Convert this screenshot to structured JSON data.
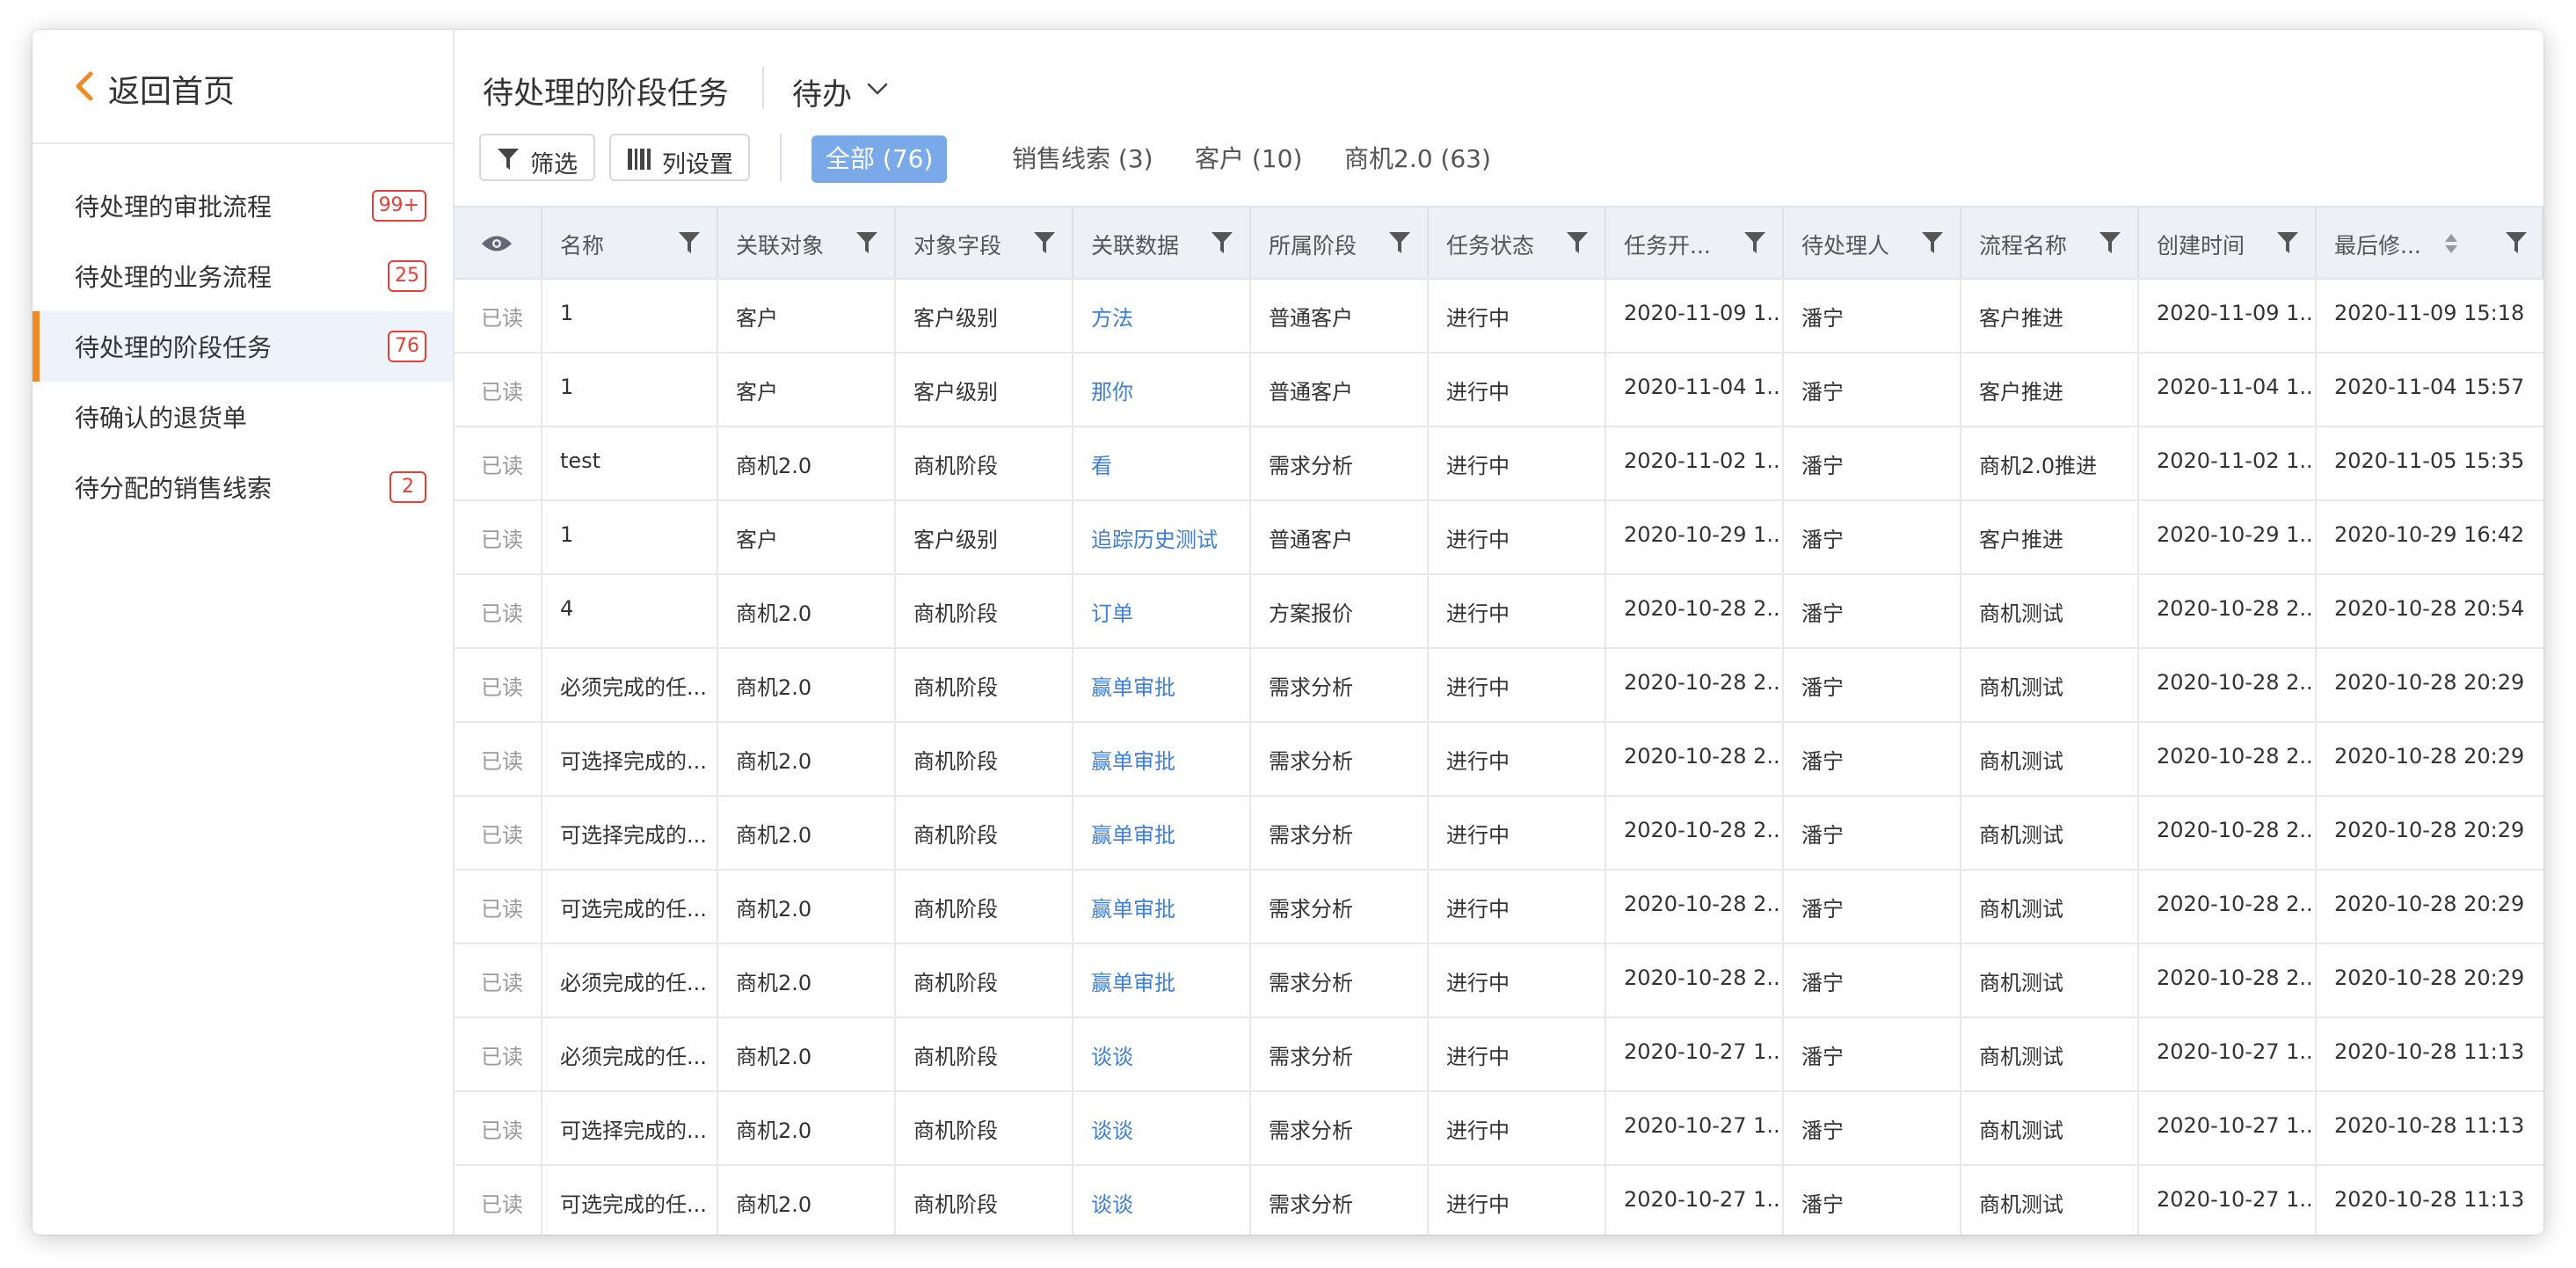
{
  "sidebar": {
    "back_label": "返回首页",
    "items": [
      {
        "label": "待处理的审批流程",
        "badge": "99+"
      },
      {
        "label": "待处理的业务流程",
        "badge": "25"
      },
      {
        "label": "待处理的阶段任务",
        "badge": "76",
        "active": true
      },
      {
        "label": "待确认的退货单",
        "badge": ""
      },
      {
        "label": "待分配的销售线索",
        "badge": "2"
      }
    ]
  },
  "header": {
    "title": "待处理的阶段任务",
    "view_select": "待办",
    "filter_button": "筛选",
    "columns_button": "列设置",
    "tabs": [
      {
        "label": "全部 (76)",
        "active": true
      },
      {
        "label": "销售线索 (3)"
      },
      {
        "label": "客户 (10)"
      },
      {
        "label": "商机2.0 (63)"
      }
    ]
  },
  "table": {
    "columns": [
      "名称",
      "关联对象",
      "对象字段",
      "关联数据",
      "所属阶段",
      "任务状态",
      "任务开...",
      "待处理人",
      "流程名称",
      "创建时间",
      "最后修..."
    ],
    "rows": [
      {
        "read": "已读",
        "cells": [
          "1",
          "客户",
          "客户级别",
          "方法",
          "普通客户",
          "进行中",
          "2020-11-09 1...",
          "潘宁",
          "客户推进",
          "2020-11-09 1...",
          "2020-11-09 15:18"
        ]
      },
      {
        "read": "已读",
        "cells": [
          "1",
          "客户",
          "客户级别",
          "那你",
          "普通客户",
          "进行中",
          "2020-11-04 1...",
          "潘宁",
          "客户推进",
          "2020-11-04 1...",
          "2020-11-04 15:57"
        ]
      },
      {
        "read": "已读",
        "cells": [
          "test",
          "商机2.0",
          "商机阶段",
          "看",
          "需求分析",
          "进行中",
          "2020-11-02 1...",
          "潘宁",
          "商机2.0推进",
          "2020-11-02 1...",
          "2020-11-05 15:35"
        ]
      },
      {
        "read": "已读",
        "cells": [
          "1",
          "客户",
          "客户级别",
          "追踪历史测试",
          "普通客户",
          "进行中",
          "2020-10-29 1...",
          "潘宁",
          "客户推进",
          "2020-10-29 1...",
          "2020-10-29 16:42"
        ]
      },
      {
        "read": "已读",
        "cells": [
          "4",
          "商机2.0",
          "商机阶段",
          "订单",
          "方案报价",
          "进行中",
          "2020-10-28 2...",
          "潘宁",
          "商机测试",
          "2020-10-28 2...",
          "2020-10-28 20:54"
        ]
      },
      {
        "read": "已读",
        "cells": [
          "必须完成的任...",
          "商机2.0",
          "商机阶段",
          "赢单审批",
          "需求分析",
          "进行中",
          "2020-10-28 2...",
          "潘宁",
          "商机测试",
          "2020-10-28 2...",
          "2020-10-28 20:29"
        ]
      },
      {
        "read": "已读",
        "cells": [
          "可选择完成的...",
          "商机2.0",
          "商机阶段",
          "赢单审批",
          "需求分析",
          "进行中",
          "2020-10-28 2...",
          "潘宁",
          "商机测试",
          "2020-10-28 2...",
          "2020-10-28 20:29"
        ]
      },
      {
        "read": "已读",
        "cells": [
          "可选择完成的...",
          "商机2.0",
          "商机阶段",
          "赢单审批",
          "需求分析",
          "进行中",
          "2020-10-28 2...",
          "潘宁",
          "商机测试",
          "2020-10-28 2...",
          "2020-10-28 20:29"
        ]
      },
      {
        "read": "已读",
        "cells": [
          "可选完成的任...",
          "商机2.0",
          "商机阶段",
          "赢单审批",
          "需求分析",
          "进行中",
          "2020-10-28 2...",
          "潘宁",
          "商机测试",
          "2020-10-28 2...",
          "2020-10-28 20:29"
        ]
      },
      {
        "read": "已读",
        "cells": [
          "必须完成的任...",
          "商机2.0",
          "商机阶段",
          "赢单审批",
          "需求分析",
          "进行中",
          "2020-10-28 2...",
          "潘宁",
          "商机测试",
          "2020-10-28 2...",
          "2020-10-28 20:29"
        ]
      },
      {
        "read": "已读",
        "cells": [
          "必须完成的任...",
          "商机2.0",
          "商机阶段",
          "谈谈",
          "需求分析",
          "进行中",
          "2020-10-27 1...",
          "潘宁",
          "商机测试",
          "2020-10-27 1...",
          "2020-10-28 11:13"
        ]
      },
      {
        "read": "已读",
        "cells": [
          "可选择完成的...",
          "商机2.0",
          "商机阶段",
          "谈谈",
          "需求分析",
          "进行中",
          "2020-10-27 1...",
          "潘宁",
          "商机测试",
          "2020-10-27 1...",
          "2020-10-28 11:13"
        ]
      },
      {
        "read": "已读",
        "cells": [
          "可选完成的任...",
          "商机2.0",
          "商机阶段",
          "谈谈",
          "需求分析",
          "进行中",
          "2020-10-27 1...",
          "潘宁",
          "商机测试",
          "2020-10-27 1...",
          "2020-10-28 11:13"
        ]
      }
    ]
  },
  "colors": {
    "accent": "#f08a24",
    "badge": "#e2413a",
    "link": "#3f7fd8",
    "active_tab": "#7aa9ea",
    "header_bg": "#edf0f5",
    "selected_row": "#eef3fb"
  }
}
